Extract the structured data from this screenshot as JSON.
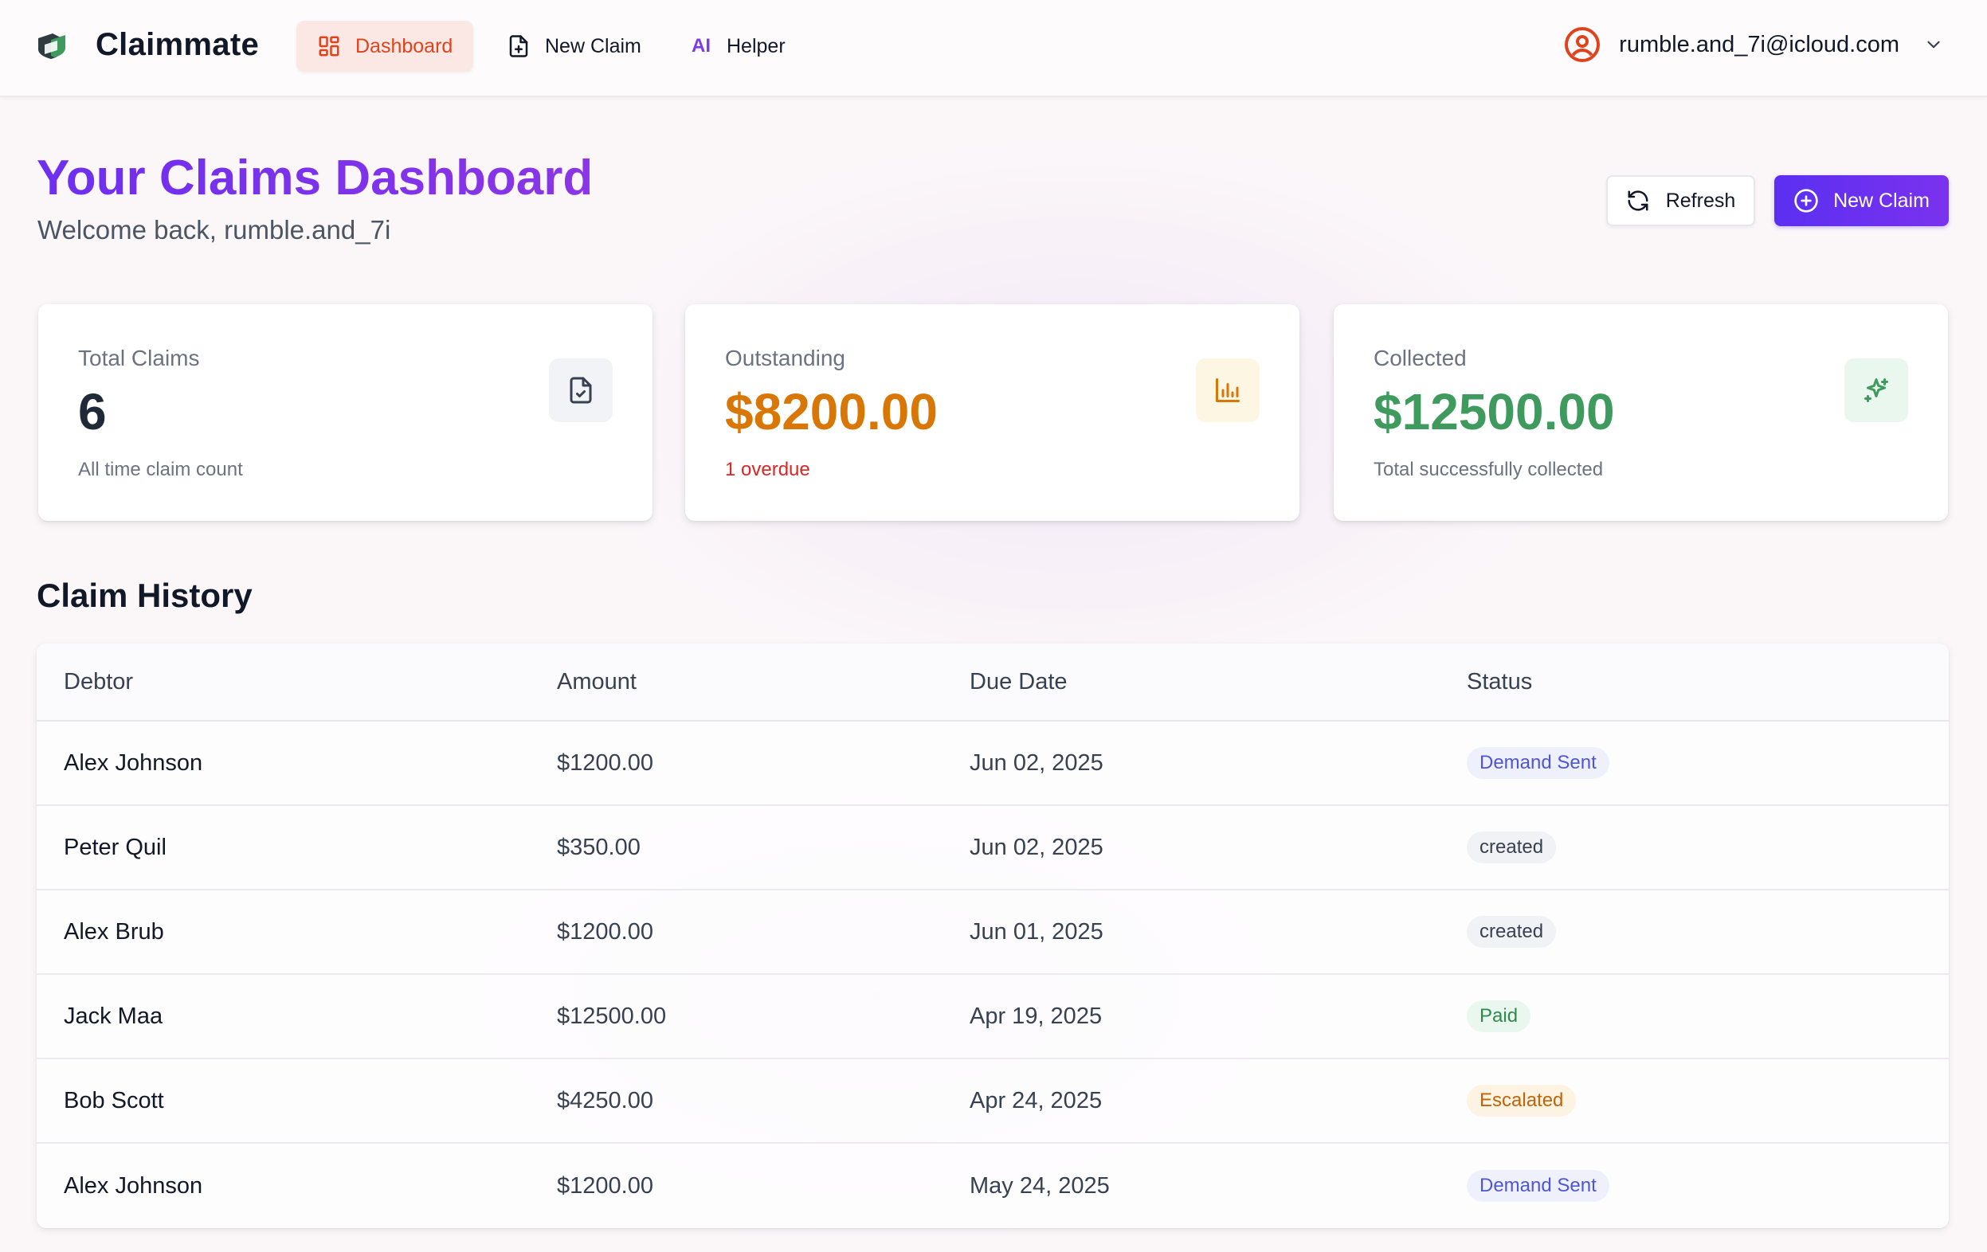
{
  "app": {
    "name": "Claimmate"
  },
  "nav": {
    "items": [
      {
        "label": "Dashboard",
        "icon": "dashboard-grid-icon",
        "active": true
      },
      {
        "label": "New Claim",
        "icon": "file-plus-icon",
        "active": false
      },
      {
        "label": "Helper",
        "prefix": "AI",
        "icon": "ai-icon",
        "active": false
      }
    ],
    "user_email": "rumble.and_7i@icloud.com"
  },
  "header": {
    "title": "Your Claims Dashboard",
    "welcome": "Welcome back, rumble.and_7i",
    "refresh_label": "Refresh",
    "new_claim_label": "New Claim"
  },
  "stats": [
    {
      "label": "Total Claims",
      "value": "6",
      "sub": "All time claim count",
      "icon": "file-check-icon",
      "value_color": "#1f2937",
      "sub_color": "#6b7280",
      "icon_bg": "#f1f3f6",
      "icon_color": "#374151"
    },
    {
      "label": "Outstanding",
      "value": "$8200.00",
      "sub": "1 overdue",
      "icon": "bar-chart-icon",
      "value_color": "#d97706",
      "sub_color": "#dc2626",
      "icon_bg": "#fdf6e3",
      "icon_color": "#d97706"
    },
    {
      "label": "Collected",
      "value": "$12500.00",
      "sub": "Total successfully collected",
      "icon": "sparkles-icon",
      "value_color": "#3f9a5e",
      "sub_color": "#6b7280",
      "icon_bg": "#eaf7ee",
      "icon_color": "#3f9a5e"
    }
  ],
  "history": {
    "title": "Claim History",
    "columns": [
      "Debtor",
      "Amount",
      "Due Date",
      "Status"
    ],
    "rows": [
      {
        "debtor": "Alex Johnson",
        "amount": "$1200.00",
        "due": "Jun 02, 2025",
        "status": "Demand Sent"
      },
      {
        "debtor": "Peter Quil",
        "amount": "$350.00",
        "due": "Jun 02, 2025",
        "status": "created"
      },
      {
        "debtor": "Alex Brub",
        "amount": "$1200.00",
        "due": "Jun 01, 2025",
        "status": "created"
      },
      {
        "debtor": "Jack Maa",
        "amount": "$12500.00",
        "due": "Apr 19, 2025",
        "status": "Paid"
      },
      {
        "debtor": "Bob Scott",
        "amount": "$4250.00",
        "due": "Apr 24, 2025",
        "status": "Escalated"
      },
      {
        "debtor": "Alex Johnson",
        "amount": "$1200.00",
        "due": "May 24, 2025",
        "status": "Demand Sent"
      }
    ]
  },
  "status_colors": {
    "Demand Sent": {
      "bg": "#eef0fb",
      "fg": "#4f55d6"
    },
    "created": {
      "bg": "#f1f2f5",
      "fg": "#374151"
    },
    "Paid": {
      "bg": "#e9f7ee",
      "fg": "#2f8a4d"
    },
    "Escalated": {
      "bg": "#fdf3e2",
      "fg": "#c0630a"
    }
  }
}
